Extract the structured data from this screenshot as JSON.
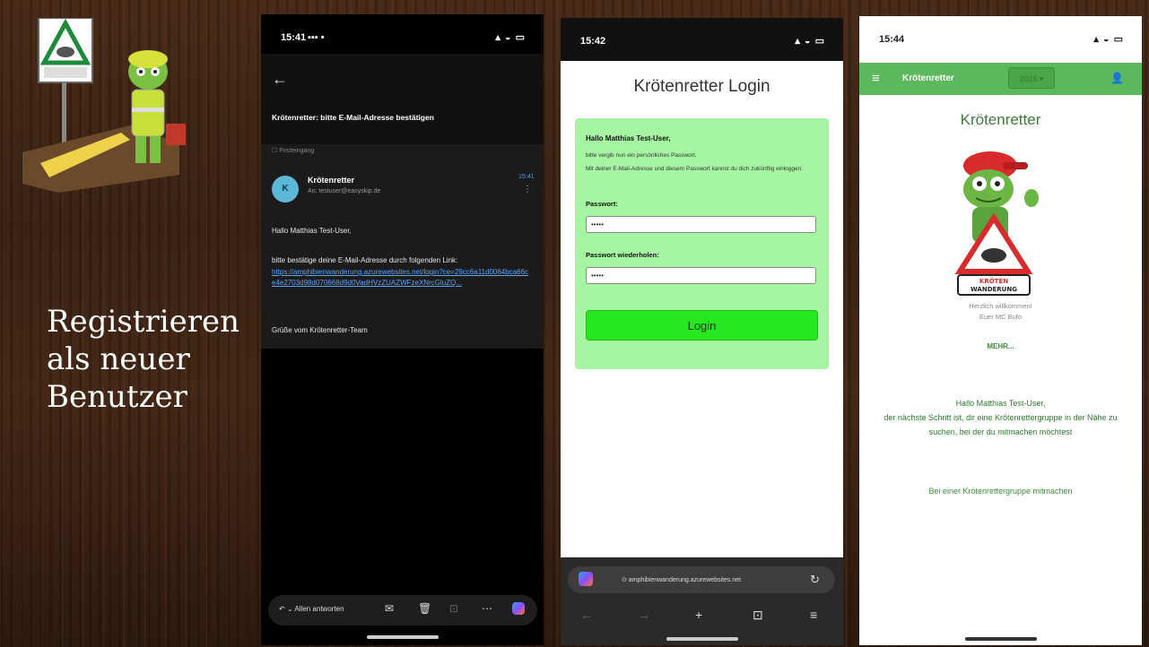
{
  "slide": {
    "title_lines": [
      "Registrieren",
      "als neuer",
      "Benutzer"
    ]
  },
  "email_phone": {
    "status_time": "15:41",
    "status_icons": "▪▪▪ •",
    "subject": "Krötenretter: bitte E-Mail-Adresse bestätigen",
    "inbox_label": "☐ Posteingang",
    "avatar_letter": "K",
    "sender": "Krötenretter",
    "recipient": "An: testuser@easyskip.de",
    "time": "15:41",
    "greeting": "Hallo Matthias Test-User,",
    "confirm_text": "bitte bestätige deine E-Mail-Adresse durch folgenden Link:",
    "confirm_link": "https://amphibienwanderung.azurewebsites.net/login?ce=29cc6a11d0064bca66ce4e2703d98d070668d9d0VadHVzZUAZWFzeXNrcGluZQ...",
    "signoff": "Grüße vom Krötenretter-Team",
    "reply_label": "Allen antworten"
  },
  "login_phone": {
    "status_time": "15:42",
    "title": "Krötenretter Login",
    "hello": "Hallo Matthias Test-User,",
    "sub1": "bitte vergib nun ein persönliches Passwort.",
    "sub2": "Mit deiner E-Mail-Adresse und diesem Passwort kannst du dich zukünftig einloggen.",
    "password_label": "Passwort:",
    "password_value": "•••••",
    "repeat_label": "Passwort wiederholen:",
    "repeat_value": "•••••",
    "login_button": "Login",
    "url": "⊙ amphibienwanderung.azurewebsites.net"
  },
  "dashboard_phone": {
    "status_time": "15:44",
    "app_title": "Krötenretter",
    "year": "2026 ▾",
    "title": "Krötenretter",
    "sign_text_1": "KRÖTEN",
    "sign_text_2": "WANDERUNG",
    "welcome_1": "Herzlich willkommen!",
    "welcome_2": "Euer MC Bufo",
    "more": "MEHR...",
    "next_step_1": "Hallo Matthias Test-User,",
    "next_step_2": "der nächste Schritt ist, dir eine Krötenrettergruppe in der Nähe zu suchen, bei der du mitmachen möchtest",
    "join_link": "Bei einer Krötenrettergruppe mitmachen"
  },
  "colors": {
    "login_card": "#a6f5a2",
    "login_button": "#27e81f",
    "app_bar": "#5cb85c",
    "link_blue": "#5aa6ff"
  }
}
